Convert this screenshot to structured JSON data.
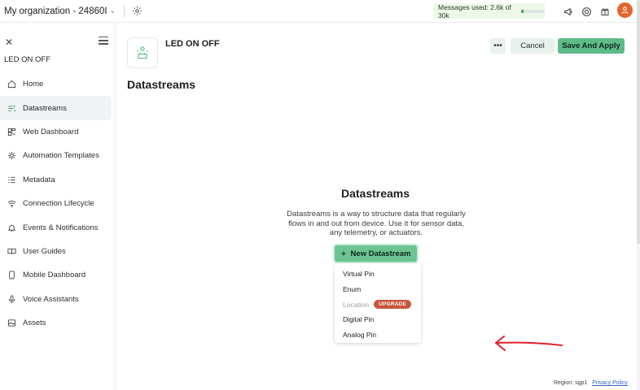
{
  "topbar": {
    "org_name": "My organization - 24860I",
    "messages_label": "Messages used: 2.6k of 30k",
    "messages_used_fraction": 0.087
  },
  "sidebar": {
    "template_name": "LED ON OFF",
    "items": [
      {
        "label": "Home",
        "icon": "home-icon"
      },
      {
        "label": "Datastreams",
        "icon": "datastreams-icon",
        "active": true
      },
      {
        "label": "Web Dashboard",
        "icon": "web-dashboard-icon"
      },
      {
        "label": "Automation Templates",
        "icon": "automation-icon"
      },
      {
        "label": "Metadata",
        "icon": "metadata-icon"
      },
      {
        "label": "Connection Lifecycle",
        "icon": "wifi-icon"
      },
      {
        "label": "Events & Notifications",
        "icon": "bell-icon"
      },
      {
        "label": "User Guides",
        "icon": "book-icon"
      },
      {
        "label": "Mobile Dashboard",
        "icon": "mobile-icon"
      },
      {
        "label": "Voice Assistants",
        "icon": "microphone-icon"
      },
      {
        "label": "Assets",
        "icon": "image-icon"
      }
    ]
  },
  "header": {
    "template_title": "LED ON OFF",
    "more_label": "•••",
    "cancel_label": "Cancel",
    "save_label": "Save And Apply"
  },
  "main": {
    "page_title": "Datastreams",
    "empty_title": "Datastreams",
    "empty_description": "Datastreams is a way to structure data that regularly flows in and out from device. Use it for sensor data, any telemetry, or actuators.",
    "new_button_label": "New Datastream",
    "dropdown": [
      {
        "label": "Virtual Pin"
      },
      {
        "label": "Enum"
      },
      {
        "label": "Location",
        "disabled": true,
        "badge": "UPGRADE"
      },
      {
        "label": "Digital Pin"
      },
      {
        "label": "Analog Pin"
      }
    ]
  },
  "footer": {
    "region": "Region: sgp1",
    "privacy_label": "Privacy Policy"
  },
  "colors": {
    "accent_green": "#5dbb8a",
    "badge_red": "#c9553e",
    "annotation_red": "#e0202a",
    "avatar_orange": "#e2652c"
  }
}
